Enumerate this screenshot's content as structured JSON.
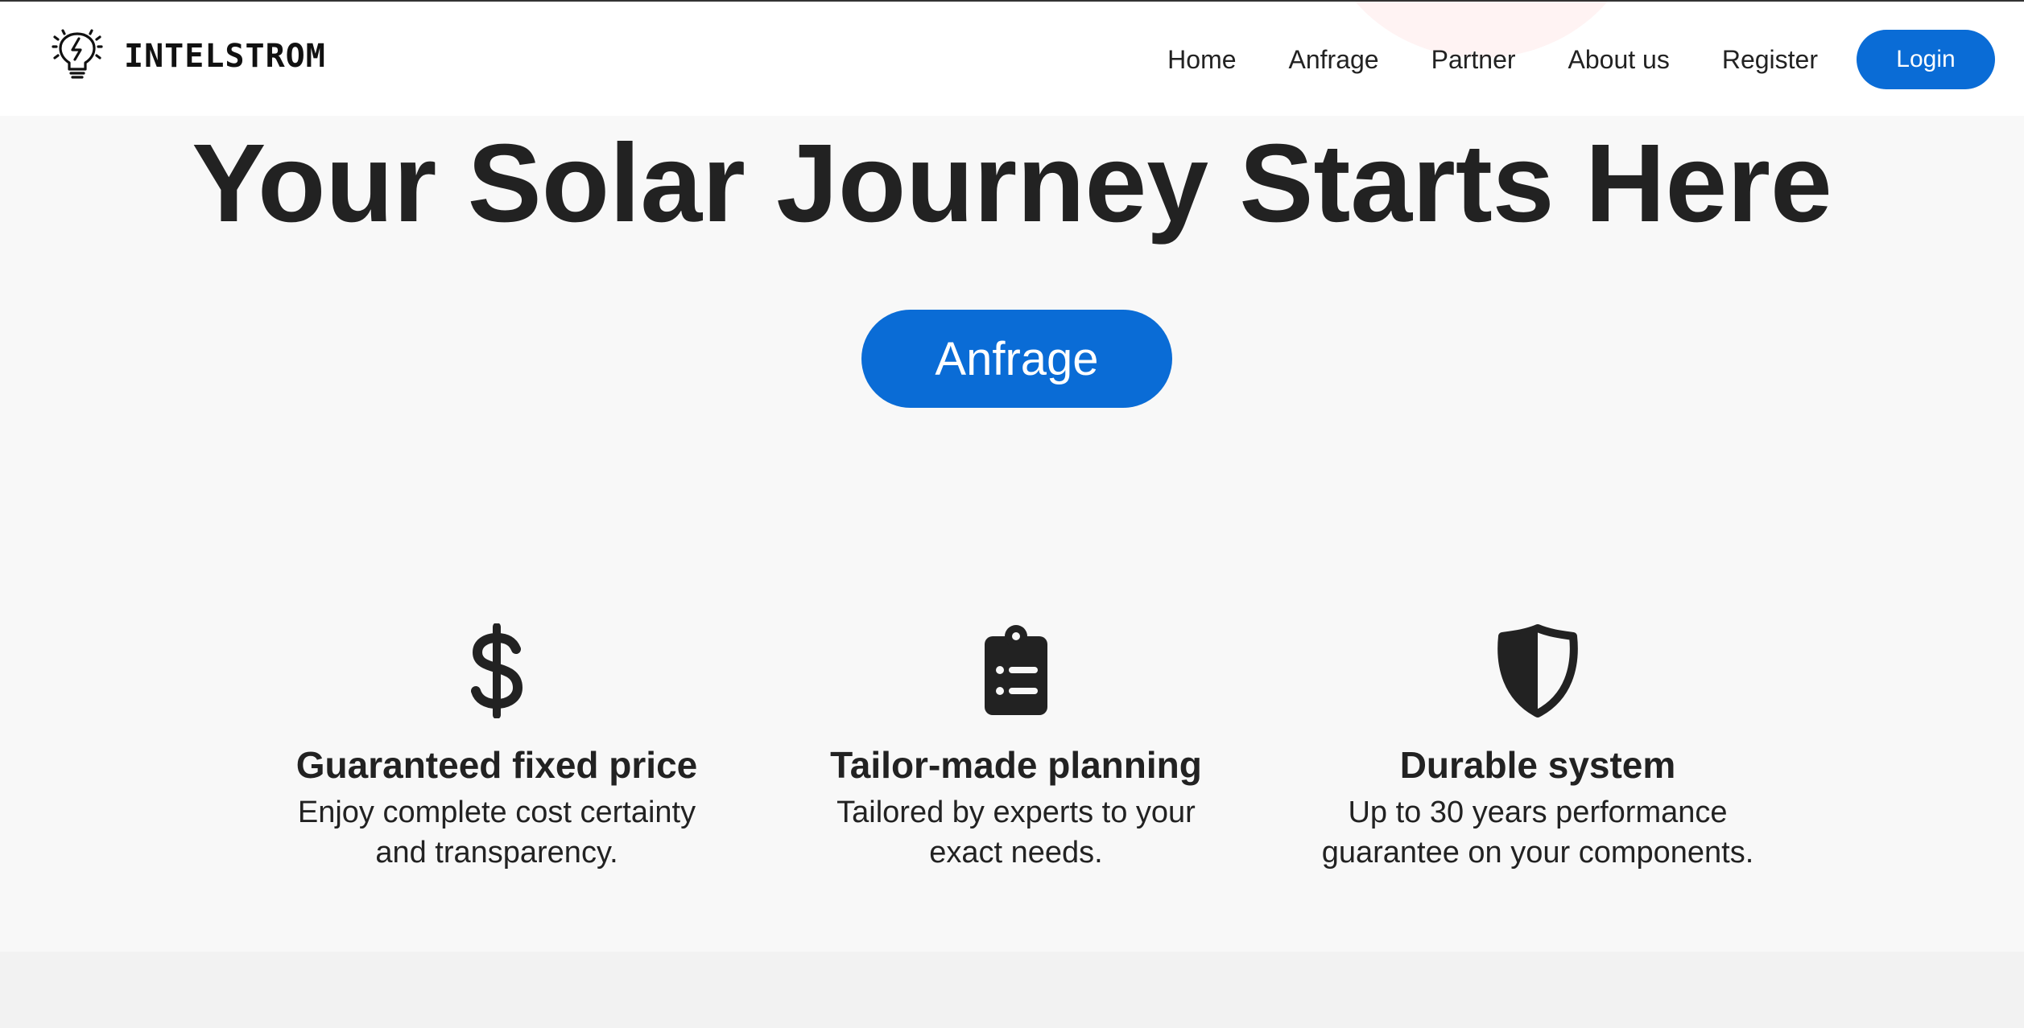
{
  "brand": {
    "name": "INTELSTROM",
    "icon": "lightbulb-bolt-icon"
  },
  "nav": {
    "items": [
      {
        "label": "Home"
      },
      {
        "label": "Anfrage"
      },
      {
        "label": "Partner"
      },
      {
        "label": "About us"
      },
      {
        "label": "Register"
      }
    ],
    "login_label": "Login"
  },
  "hero": {
    "title": "Your Solar Journey Starts Here",
    "cta_label": "Anfrage"
  },
  "features": [
    {
      "icon": "dollar-icon",
      "title": "Guaranteed fixed price",
      "text": "Enjoy complete cost certainty and transparency."
    },
    {
      "icon": "clipboard-list-icon",
      "title": "Tailor-made planning",
      "text": "Tailored by experts to your exact needs."
    },
    {
      "icon": "shield-icon",
      "title": "Durable system",
      "text": "Up to 30 years performance guarantee on your components."
    }
  ],
  "colors": {
    "primary": "#0a6cd6",
    "text": "#222222",
    "background": "#f8f8f8",
    "header_background": "#ffffff"
  }
}
